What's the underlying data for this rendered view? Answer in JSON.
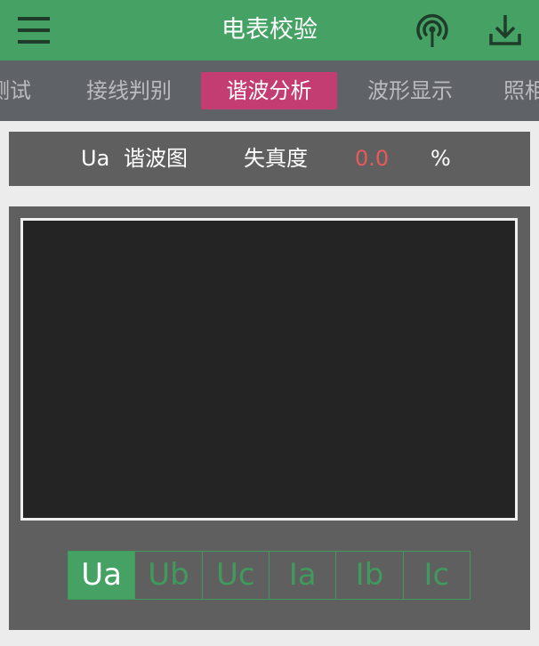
{
  "app": {
    "title": "电表校验"
  },
  "icons": {
    "menu": "menu-icon",
    "signal": "signal-tower-icon",
    "download": "download-icon"
  },
  "tabs": [
    {
      "label": "测试",
      "active": false
    },
    {
      "label": "接线判别",
      "active": false
    },
    {
      "label": "谐波分析",
      "active": true
    },
    {
      "label": "波形显示",
      "active": false
    },
    {
      "label": "照相",
      "active": false
    }
  ],
  "info": {
    "channel": "Ua",
    "chart_label": "谐波图",
    "thd_label": "失真度",
    "thd_value": "0.0",
    "thd_unit": "%"
  },
  "channels": [
    {
      "label": "Ua",
      "active": true
    },
    {
      "label": "Ub",
      "active": false
    },
    {
      "label": "Uc",
      "active": false
    },
    {
      "label": "Ia",
      "active": false
    },
    {
      "label": "Ib",
      "active": false
    },
    {
      "label": "Ic",
      "active": false
    }
  ],
  "colors": {
    "primary": "#45a264",
    "active_tab": "#c33d73",
    "thd_value": "#e85a5a",
    "chart_bg": "#242424"
  }
}
